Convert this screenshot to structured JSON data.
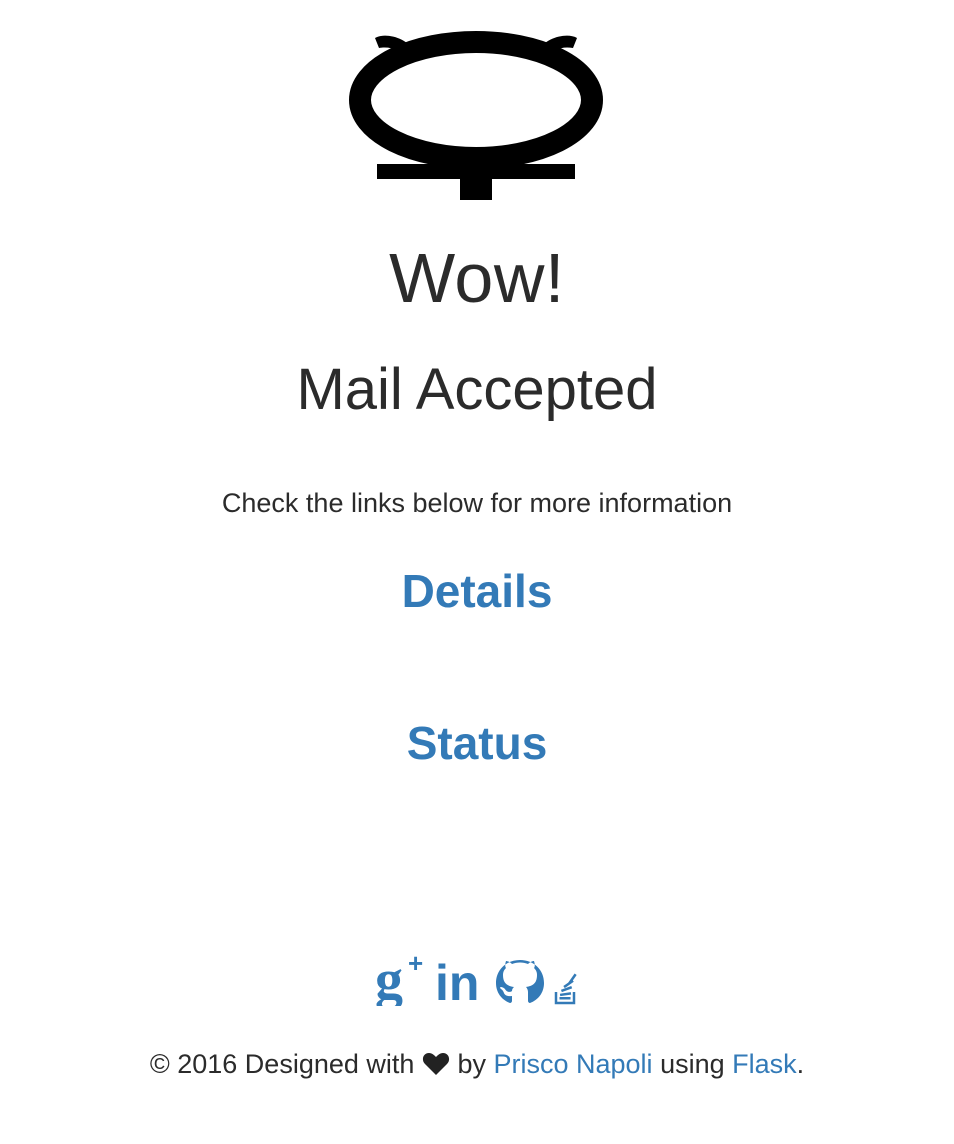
{
  "logo": {
    "icon": "mercury-symbol-icon",
    "color": "#000000"
  },
  "hero": {
    "title": "Wow!",
    "subtitle": "Mail Accepted",
    "message": "Check the links below for more information"
  },
  "links": {
    "details": "Details",
    "status": "Status",
    "color": "#337ab7"
  },
  "social": {
    "icons": [
      "google-plus-icon",
      "linkedin-icon",
      "github-icon",
      "stackoverflow-icon"
    ]
  },
  "footer": {
    "prefix": "© 2016 Designed with",
    "heart_icon": "heart-icon",
    "by": "by",
    "author": "Prisco Napoli",
    "using": "using",
    "framework": "Flask",
    "suffix": "."
  }
}
